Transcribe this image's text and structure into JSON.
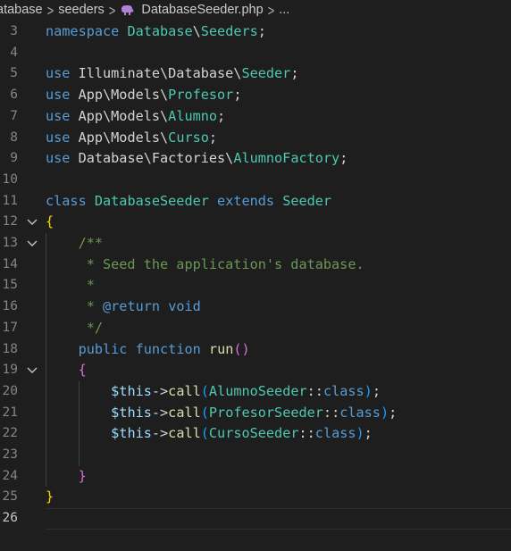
{
  "breadcrumb": {
    "items": [
      "atabase",
      "seeders",
      "DatabaseSeeder.php",
      "..."
    ]
  },
  "icons": {
    "file_icon": "php-elephant-icon",
    "fold_icon": "chevron-down-icon",
    "php_color": "#b180d7"
  },
  "editor": {
    "lines": [
      {
        "num": "3",
        "tokens": [
          [
            "kw",
            "namespace"
          ],
          [
            "id",
            " "
          ],
          [
            "ns",
            "Database"
          ],
          [
            "id",
            "\\"
          ],
          [
            "ns",
            "Seeders"
          ],
          [
            "id",
            ";"
          ]
        ]
      },
      {
        "num": "4",
        "tokens": []
      },
      {
        "num": "5",
        "tokens": [
          [
            "kw",
            "use"
          ],
          [
            "id",
            " Illuminate\\Database\\"
          ],
          [
            "cls",
            "Seeder"
          ],
          [
            "id",
            ";"
          ]
        ]
      },
      {
        "num": "6",
        "tokens": [
          [
            "kw",
            "use"
          ],
          [
            "id",
            " App\\Models\\"
          ],
          [
            "cls",
            "Profesor"
          ],
          [
            "id",
            ";"
          ]
        ]
      },
      {
        "num": "7",
        "tokens": [
          [
            "kw",
            "use"
          ],
          [
            "id",
            " App\\Models\\"
          ],
          [
            "cls",
            "Alumno"
          ],
          [
            "id",
            ";"
          ]
        ]
      },
      {
        "num": "8",
        "tokens": [
          [
            "kw",
            "use"
          ],
          [
            "id",
            " App\\Models\\"
          ],
          [
            "cls",
            "Curso"
          ],
          [
            "id",
            ";"
          ]
        ]
      },
      {
        "num": "9",
        "tokens": [
          [
            "kw",
            "use"
          ],
          [
            "id",
            " Database\\Factories\\"
          ],
          [
            "cls",
            "AlumnoFactory"
          ],
          [
            "id",
            ";"
          ]
        ]
      },
      {
        "num": "10",
        "tokens": []
      },
      {
        "num": "11",
        "tokens": [
          [
            "kw",
            "class"
          ],
          [
            "id",
            " "
          ],
          [
            "cls",
            "DatabaseSeeder"
          ],
          [
            "id",
            " "
          ],
          [
            "kw",
            "extends"
          ],
          [
            "id",
            " "
          ],
          [
            "cls",
            "Seeder"
          ]
        ]
      },
      {
        "num": "12",
        "fold": true,
        "tokens": [
          [
            "br1",
            "{"
          ]
        ]
      },
      {
        "num": "13",
        "fold": true,
        "tokens": [
          [
            "id",
            "    "
          ],
          [
            "cm",
            "/**"
          ]
        ]
      },
      {
        "num": "14",
        "tokens": [
          [
            "id",
            "     "
          ],
          [
            "cm",
            "* Seed the application's database."
          ]
        ]
      },
      {
        "num": "15",
        "tokens": [
          [
            "id",
            "     "
          ],
          [
            "cm",
            "*"
          ]
        ]
      },
      {
        "num": "16",
        "tokens": [
          [
            "id",
            "     "
          ],
          [
            "cm",
            "* "
          ],
          [
            "kw",
            "@return"
          ],
          [
            "id",
            " "
          ],
          [
            "kw",
            "void"
          ]
        ]
      },
      {
        "num": "17",
        "tokens": [
          [
            "id",
            "     "
          ],
          [
            "cm",
            "*/"
          ]
        ]
      },
      {
        "num": "18",
        "tokens": [
          [
            "id",
            "    "
          ],
          [
            "kw",
            "public"
          ],
          [
            "id",
            " "
          ],
          [
            "kw",
            "function"
          ],
          [
            "id",
            " "
          ],
          [
            "fn",
            "run"
          ],
          [
            "br2",
            "()"
          ]
        ]
      },
      {
        "num": "19",
        "fold": true,
        "tokens": [
          [
            "id",
            "    "
          ],
          [
            "br2",
            "{"
          ]
        ]
      },
      {
        "num": "20",
        "tokens": [
          [
            "id",
            "        "
          ],
          [
            "var",
            "$this"
          ],
          [
            "id",
            "->"
          ],
          [
            "fn",
            "call"
          ],
          [
            "br3",
            "("
          ],
          [
            "cls",
            "AlumnoSeeder"
          ],
          [
            "id",
            "::"
          ],
          [
            "kw",
            "class"
          ],
          [
            "br3",
            ")"
          ],
          [
            "id",
            ";"
          ]
        ]
      },
      {
        "num": "21",
        "tokens": [
          [
            "id",
            "        "
          ],
          [
            "var",
            "$this"
          ],
          [
            "id",
            "->"
          ],
          [
            "fn",
            "call"
          ],
          [
            "br3",
            "("
          ],
          [
            "cls",
            "ProfesorSeeder"
          ],
          [
            "id",
            "::"
          ],
          [
            "kw",
            "class"
          ],
          [
            "br3",
            ")"
          ],
          [
            "id",
            ";"
          ]
        ]
      },
      {
        "num": "22",
        "tokens": [
          [
            "id",
            "        "
          ],
          [
            "var",
            "$this"
          ],
          [
            "id",
            "->"
          ],
          [
            "fn",
            "call"
          ],
          [
            "br3",
            "("
          ],
          [
            "cls",
            "CursoSeeder"
          ],
          [
            "id",
            "::"
          ],
          [
            "kw",
            "class"
          ],
          [
            "br3",
            ")"
          ],
          [
            "id",
            ";"
          ]
        ]
      },
      {
        "num": "23",
        "tokens": []
      },
      {
        "num": "24",
        "tokens": [
          [
            "id",
            "    "
          ],
          [
            "br2",
            "}"
          ]
        ]
      },
      {
        "num": "25",
        "tokens": [
          [
            "br1",
            "}"
          ]
        ]
      },
      {
        "num": "26",
        "active": true,
        "tokens": []
      }
    ]
  }
}
